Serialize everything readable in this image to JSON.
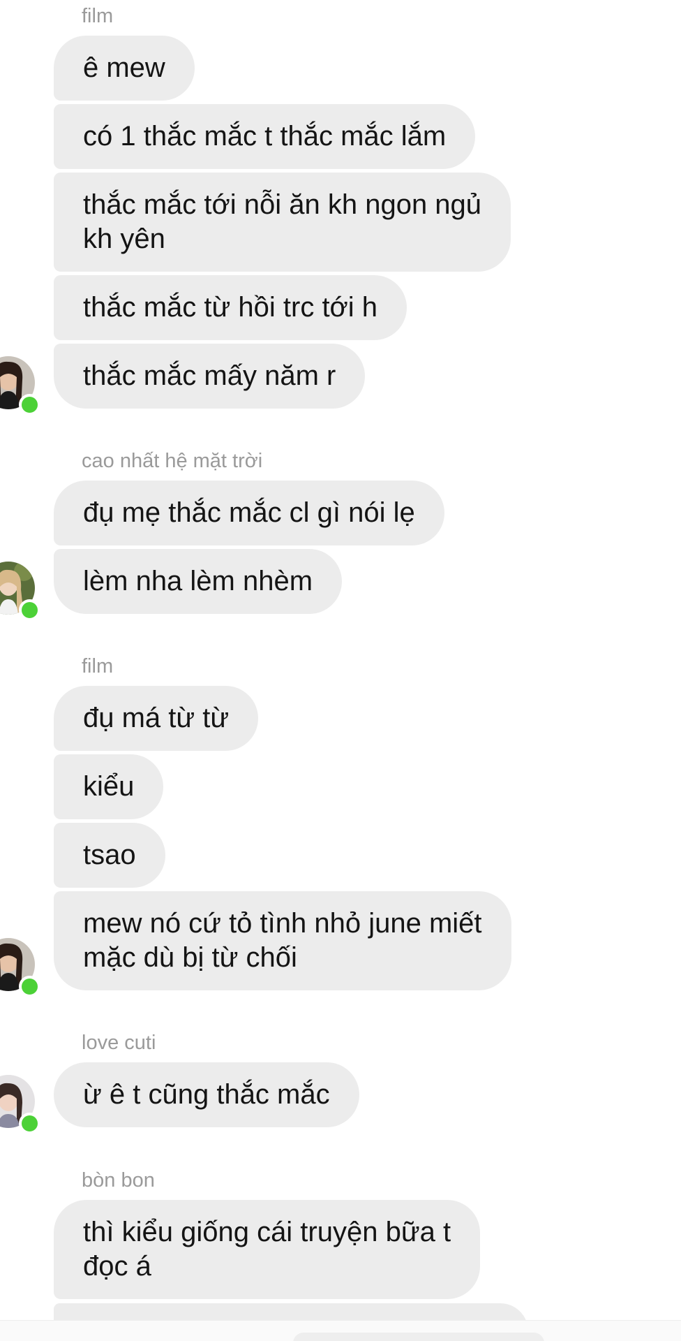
{
  "groups": [
    {
      "sender": "film",
      "messages": [
        "ê mew",
        "có 1 thắc mắc t thắc mắc lắm",
        "thắc mắc tới nỗi ăn kh ngon ngủ\nkh yên",
        "thắc mắc từ hồi trc tới h",
        "thắc mắc mấy năm r"
      ],
      "avatar": "avatar-dark-hair"
    },
    {
      "sender": "cao nhất hệ mặt trời",
      "messages": [
        "đụ mẹ thắc mắc cl gì nói lẹ",
        "lèm nha lèm nhèm"
      ],
      "avatar": "avatar-blonde-outdoor"
    },
    {
      "sender": "film",
      "messages": [
        "đụ má từ từ",
        "kiểu",
        "tsao",
        "mew nó cứ tỏ tình nhỏ june miết\nmặc dù bị từ chối"
      ],
      "avatar": "avatar-dark-hair"
    },
    {
      "sender": "love cuti",
      "messages": [
        "ừ ê t cũng thắc mắc"
      ],
      "avatar": "avatar-selfie"
    },
    {
      "sender": "bòn bon",
      "messages": [
        "thì kiểu giống cái truyện bữa t\nđọc á",
        ""
      ],
      "avatar": ""
    }
  ],
  "colors": {
    "bubble": "#ececec",
    "sender_text": "#9a9a9a",
    "online": "#4cd137"
  }
}
